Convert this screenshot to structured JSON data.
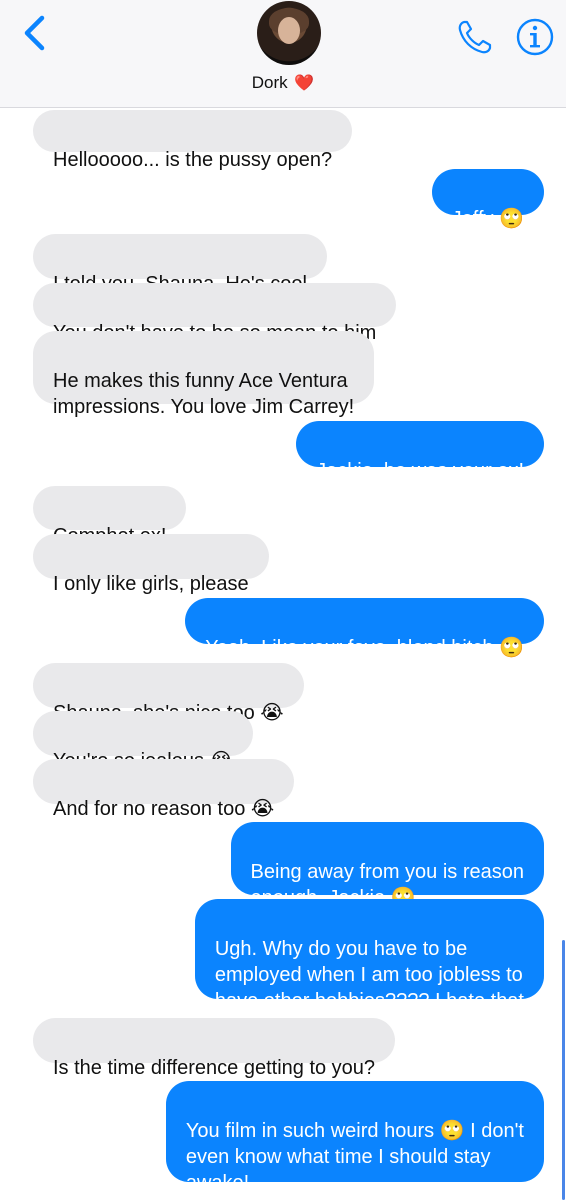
{
  "header": {
    "contact_name": "Dork",
    "heart": "❤️",
    "back_icon": "chevron-left",
    "phone_icon": "phone",
    "info_icon": "info"
  },
  "colors": {
    "accent": "#0b84fe",
    "incoming_bubble": "#e9e9eb",
    "header_bg": "#f7f7f9"
  },
  "messages": [
    {
      "dir": "in",
      "text": "Hellooooo... is the pussy open?"
    },
    {
      "dir": "out",
      "text": "Jeffy 🙄"
    },
    {
      "dir": "in",
      "text": "I told you, Shauna. He's cool"
    },
    {
      "dir": "in",
      "text": "You don't have to be so mean to him"
    },
    {
      "dir": "in",
      "text": "He makes this funny Ace Ventura\nimpressions. You love Jim Carrey!"
    },
    {
      "dir": "out",
      "text": "Jackie, he was your ex!"
    },
    {
      "dir": "in",
      "text": "Comphet ex!"
    },
    {
      "dir": "in",
      "text": "I only like girls, please"
    },
    {
      "dir": "out",
      "text": "Yeah. Like your fave, blond bitch 🙄"
    },
    {
      "dir": "in",
      "text": "Shauna, she's nice too 😭"
    },
    {
      "dir": "in",
      "text": "You're so jealous 😭"
    },
    {
      "dir": "in",
      "text": "And for no reason too 😭"
    },
    {
      "dir": "out",
      "text": "Being away from you is reason\nenough, Jackie 🙄"
    },
    {
      "dir": "out",
      "text": "Ugh. Why do you have to be\nemployed when I am too jobless to\nhave other hobbies???? I hate that"
    },
    {
      "dir": "in",
      "text": "Is the time difference getting to you?"
    },
    {
      "dir": "out",
      "text": "You film in such weird hours 🙄 I don't\neven know what time I should stay\nawake!"
    }
  ]
}
